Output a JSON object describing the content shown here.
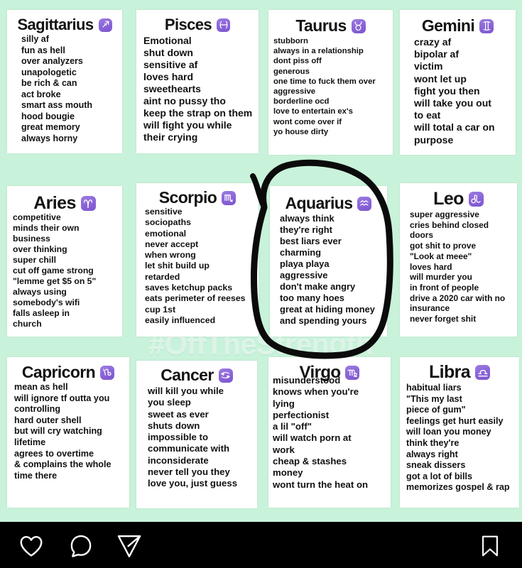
{
  "post": {
    "watermark": "#OffTheStrength",
    "background_color": "#c9f2da",
    "badge_color": "#8a63d8",
    "annotation": "hand-drawn-black-circle-around-aquarius"
  },
  "cards": [
    {
      "sign": "Sagittarius",
      "glyph": "sagittarius-glyph",
      "traits": [
        "silly af",
        "fun as hell",
        "over analyzers",
        "unapologetic",
        "be rich & can",
        "act broke",
        "smart ass mouth",
        "hood bougie",
        "great memory",
        "always horny"
      ]
    },
    {
      "sign": "Pisces",
      "glyph": "pisces-glyph",
      "traits": [
        "Emotional",
        "shut down",
        "sensitive af",
        "loves hard",
        "sweethearts",
        "aint no pussy tho",
        "keep the strap on them",
        "will fight you while",
        "their crying"
      ]
    },
    {
      "sign": "Taurus",
      "glyph": "taurus-glyph",
      "traits": [
        "stubborn",
        "always in a  relationship",
        "dont piss off",
        "generous",
        "one time to fuck them over",
        "aggressive",
        "borderline ocd",
        "love to entertain ex's",
        "wont come over if",
        "yo house dirty"
      ]
    },
    {
      "sign": "Gemini",
      "glyph": "gemini-glyph",
      "traits": [
        "crazy af",
        "bipolar af",
        "victim",
        "wont let up",
        "fight you then",
        "will take you out",
        "to eat",
        "will total a car on",
        "purpose"
      ]
    },
    {
      "sign": "Aries",
      "glyph": "aries-glyph",
      "traits": [
        "competitive",
        "minds their own",
        "business",
        "over thinking",
        "super chill",
        "cut off game strong",
        "\"lemme get $5 on 5\"",
        "always using",
        "somebody's wifi",
        "falls asleep in",
        "church"
      ]
    },
    {
      "sign": "Scorpio",
      "glyph": "scorpio-glyph",
      "traits": [
        "sensitive",
        "sociopaths",
        "emotional",
        "never accept",
        "when wrong",
        "let shit build up",
        "retarded",
        "saves ketchup packs",
        "eats perimeter of reeses",
        "cup 1st",
        "easily influenced"
      ]
    },
    {
      "sign": "Aquarius",
      "glyph": "aquarius-glyph",
      "traits": [
        "always think",
        "they're right",
        "best liars ever",
        "charming",
        "playa playa",
        "aggressive",
        "don't make angry",
        "too many hoes",
        "great at hiding money",
        "and spending yours"
      ]
    },
    {
      "sign": "Leo",
      "glyph": "leo-glyph",
      "traits": [
        "super aggressive",
        "cries behind closed",
        "doors",
        "got shit to prove",
        "\"Look at meee\"",
        "loves hard",
        "will murder you",
        "in front of people",
        "drive a 2020 car with no",
        "insurance",
        "never forget shit"
      ]
    },
    {
      "sign": "Capricorn",
      "glyph": "capricorn-glyph",
      "traits": [
        "mean as hell",
        "will ignore tf outta you",
        "controlling",
        "hard outer shell",
        "but will cry watching",
        "lifetime",
        "agrees to overtime",
        "& complains the whole",
        "time there"
      ]
    },
    {
      "sign": "Cancer",
      "glyph": "cancer-glyph",
      "traits": [
        "will kill you while",
        "you sleep",
        "sweet as ever",
        "shuts down",
        "impossible to",
        "communicate with",
        "inconsiderate",
        "never tell you they",
        "love you, just guess"
      ]
    },
    {
      "sign": "Virgo",
      "glyph": "virgo-glyph",
      "traits": [
        "misunderstood",
        "knows when you're",
        "lying",
        "perfectionist",
        "a lil \"off\"",
        "will watch porn at",
        "work",
        "cheap & stashes",
        "money",
        "wont turn the heat on"
      ]
    },
    {
      "sign": "Libra",
      "glyph": "libra-glyph",
      "traits": [
        "habitual liars",
        "\"This my last",
        "piece of gum\"",
        "feelings get hurt easily",
        "will loan you money",
        "think they're",
        "always right",
        "sneak dissers",
        "got a lot of bills",
        "memorizes gospel & rap"
      ]
    }
  ],
  "action_bar": {
    "like": "Like",
    "comment": "Comment",
    "share": "Share",
    "save": "Save"
  }
}
